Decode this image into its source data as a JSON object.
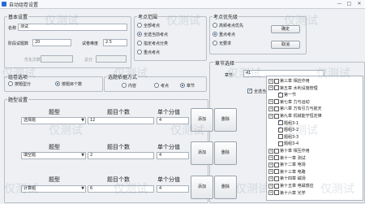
{
  "window": {
    "title": "自动组卷设置",
    "minimize": "—",
    "maximize": "□",
    "close": "✕"
  },
  "basic": {
    "legend": "基本设置",
    "exam_name_label": "名称",
    "exam_name_value": "测试",
    "total_score_label": "阶段试题数",
    "total_score_value": "20",
    "difficulty_label": "试卷难度",
    "difficulty_value": "2.5",
    "pass_label": "优化次数",
    "pass_value": "",
    "score_label": "总分",
    "score_value": ""
  },
  "cover": {
    "legend": "考点范围",
    "options": [
      "全部考点",
      "全选当前考点",
      "指定考点分类",
      "重点考点"
    ]
  },
  "priority": {
    "legend": "考点优先级",
    "options": [
      "高频考点优先",
      "重点考点",
      "无要求"
    ],
    "ok_label": "确定",
    "cancel_label": "取消"
  },
  "group": {
    "legend": "组卷选项",
    "options": [
      "按题型分",
      "按题目个数"
    ]
  },
  "basis": {
    "legend": "选题依据方式",
    "options": [
      "内容",
      "考点",
      "章节"
    ]
  },
  "chapter": {
    "legend": "章节选择",
    "chapter_label": "章节",
    "chapter_value": "41",
    "check_all_label": "全选当前"
  },
  "tree": [
    {
      "label": "第三章 相应作用",
      "checked": false,
      "indent": 0
    },
    {
      "label": "第五章 水利设施管理",
      "checked": false,
      "indent": 0
    },
    {
      "label": "第一节",
      "checked": true,
      "indent": 1
    },
    {
      "label": "第七章 力与运动",
      "checked": false,
      "indent": 0
    },
    {
      "label": "第八章 万有引力与航天",
      "checked": false,
      "indent": 0
    },
    {
      "label": "第九章 机械能守恒定律",
      "checked": false,
      "indent": 0
    },
    {
      "label": "题组3-1",
      "checked": true,
      "indent": 1
    },
    {
      "label": "题组3-2",
      "checked": true,
      "indent": 1
    },
    {
      "label": "题组3-3",
      "checked": false,
      "indent": 1
    },
    {
      "label": "题组3-4",
      "checked": false,
      "indent": 1
    },
    {
      "label": "第十章 相互作用",
      "checked": false,
      "indent": 0
    },
    {
      "label": "第十一章 测试",
      "checked": false,
      "indent": 0
    },
    {
      "label": "第十二章 电场",
      "checked": false,
      "indent": 0
    },
    {
      "label": "第十三章 电路",
      "checked": false,
      "indent": 0
    },
    {
      "label": "第十四章 磁场",
      "checked": false,
      "indent": 0
    },
    {
      "label": "第十五章 电磁感应",
      "checked": false,
      "indent": 0
    },
    {
      "label": "第十六章 光学",
      "checked": false,
      "indent": 0
    }
  ],
  "types": {
    "legend": "题型设置",
    "add_label": "添加",
    "delete_label": "删除",
    "header_type": "题型",
    "header_count": "题目个数",
    "header_score": "单个分值",
    "rows": [
      {
        "type": "选择题",
        "count": "12",
        "score": "4"
      },
      {
        "type": "填空题",
        "count": "2",
        "score": "4"
      },
      {
        "type": "计算题",
        "count": "6",
        "score": "4"
      }
    ]
  },
  "watermark": "仅测试"
}
